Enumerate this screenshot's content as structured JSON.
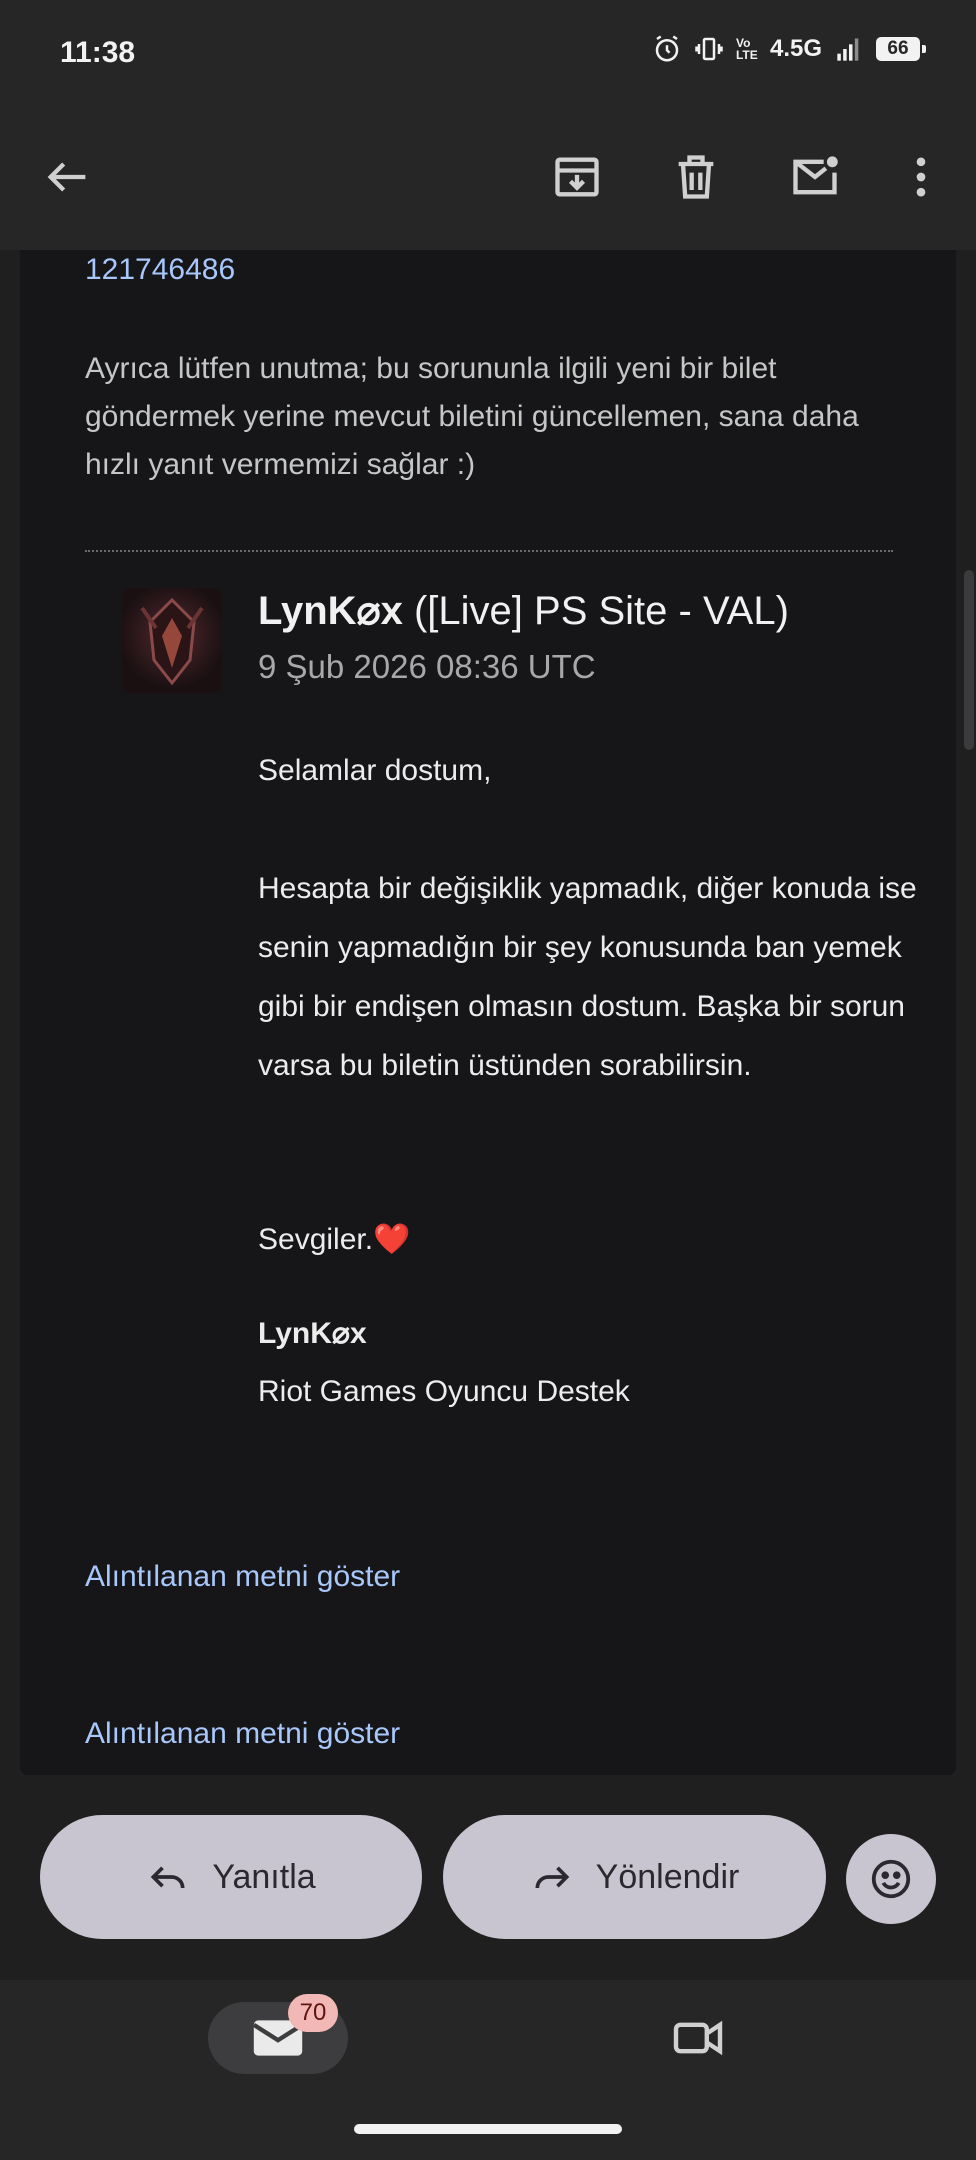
{
  "status_bar": {
    "time": "11:38",
    "network": "4.5G",
    "volte": "Vo LTE",
    "battery": "66"
  },
  "toolbar": {
    "back_icon": "arrow-left-icon",
    "archive_icon": "archive-icon",
    "delete_icon": "trash-icon",
    "mark_unread_icon": "mail-unread-icon",
    "more_icon": "more-vertical-icon"
  },
  "email": {
    "ticket_number": "121746486",
    "notice": "Ayrıca lütfen unutma; bu sorununla ilgili yeni bir bilet göndermek yerine mevcut biletini güncellemen, sana daha hızlı yanıt vermemizi sağlar :)",
    "sender_name": "LynK⌀x",
    "sender_team": "([Live] PS Site - VAL)",
    "date": "9 Şub 2026 08:36 UTC",
    "greeting": "Selamlar dostum,",
    "body": "Hesapta bir değişiklik yapmadık, diğer konuda ise senin yapmadığın bir şey konusunda ban yemek gibi bir endişen olmasın dostum. Başka bir sorun varsa bu biletin üstünden sorabilirsin.",
    "closing": "Sevgiler.❤️",
    "signature_name": "LynK⌀x",
    "signature_org": "Riot Games Oyuncu Destek",
    "show_quoted_1": "Alıntılanan metni göster",
    "show_quoted_2": "Alıntılanan metni göster"
  },
  "actions": {
    "reply_label": "Yanıtla",
    "forward_label": "Yönlendir",
    "emoji_icon": "emoji-smile-icon"
  },
  "bottom_nav": {
    "mail_badge": "70",
    "mail_icon": "mail-icon",
    "meet_icon": "video-camera-icon"
  }
}
